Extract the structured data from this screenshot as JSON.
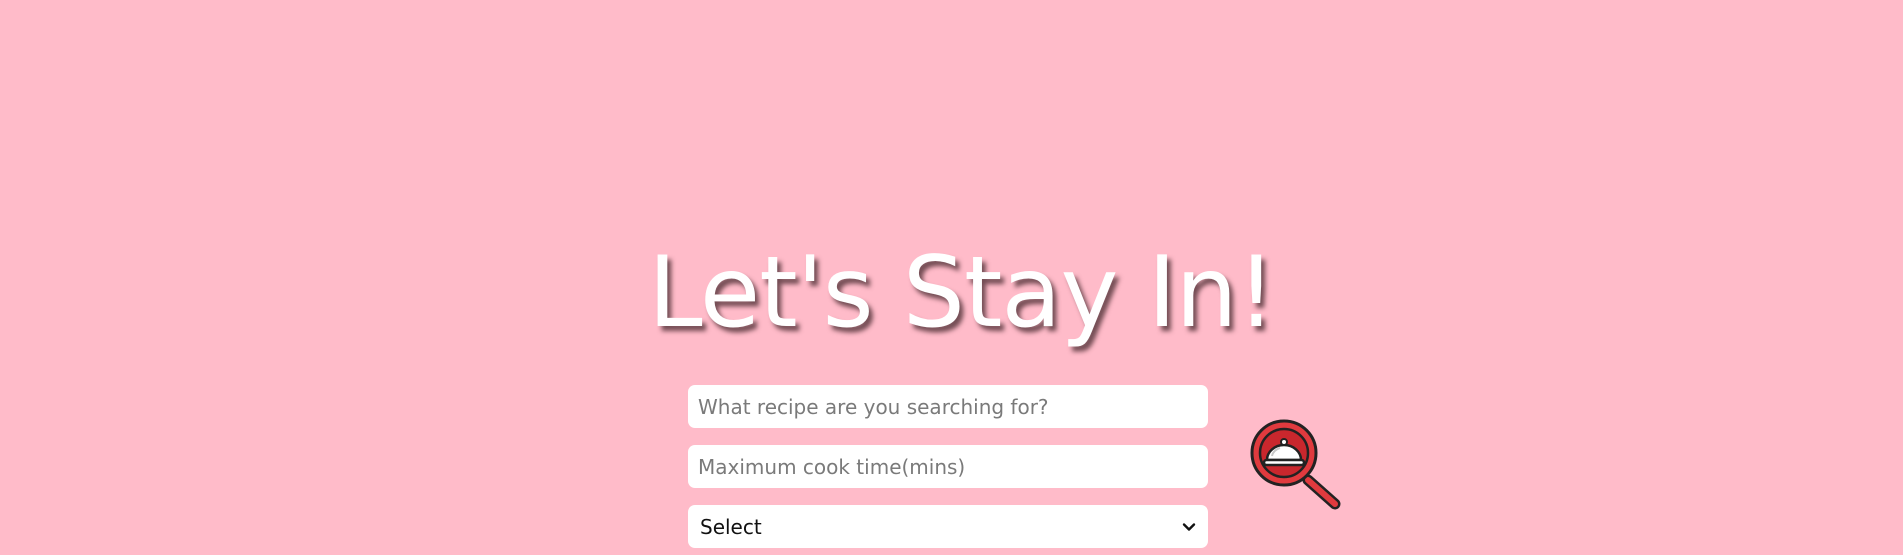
{
  "hero": {
    "title": "Let's Stay In!"
  },
  "search_form": {
    "recipe_input": {
      "value": "",
      "placeholder": "What recipe are you searching for?"
    },
    "cook_time_input": {
      "value": "",
      "placeholder": "Maximum cook time(mins)"
    },
    "category_select": {
      "selected": "Select"
    },
    "search_button": {
      "icon": "recipe-search-icon"
    }
  },
  "colors": {
    "background": "#ffbbc9",
    "title_text": "#ffffff",
    "icon_red": "#e03a3e",
    "icon_outline": "#222222"
  }
}
